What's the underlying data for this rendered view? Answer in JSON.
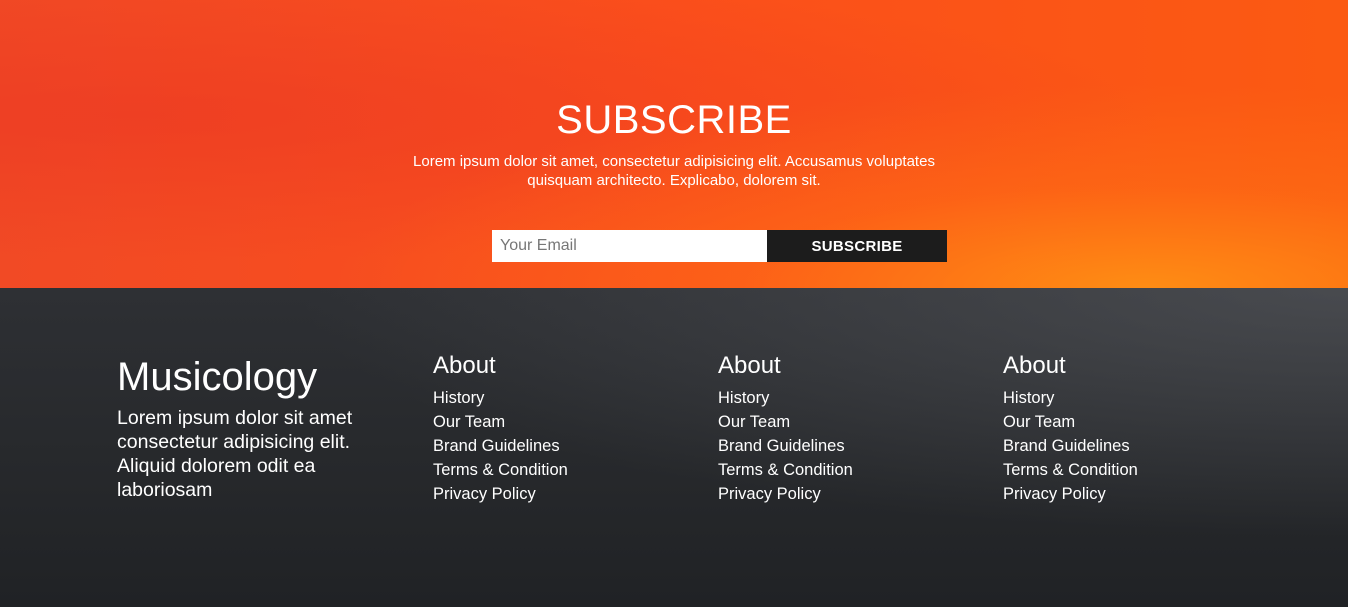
{
  "subscribe": {
    "title": "SUBSCRIBE",
    "description": "Lorem ipsum dolor sit amet, consectetur adipisicing elit. Accusamus voluptates quisquam architecto. Explicabo, dolorem sit.",
    "email_placeholder": "Your Email",
    "email_value": "",
    "button_label": "SUBSCRIBE"
  },
  "footer": {
    "brand": {
      "name": "Musicology",
      "description": "Lorem ipsum dolor sit amet consectetur adipisicing elit. Aliquid dolorem odit ea laboriosam"
    },
    "columns": [
      {
        "title": "About",
        "links": [
          "History",
          "Our Team",
          "Brand Guidelines",
          "Terms & Condition",
          "Privacy Policy"
        ]
      },
      {
        "title": "About",
        "links": [
          "History",
          "Our Team",
          "Brand Guidelines",
          "Terms & Condition",
          "Privacy Policy"
        ]
      },
      {
        "title": "About",
        "links": [
          "History",
          "Our Team",
          "Brand Guidelines",
          "Terms & Condition",
          "Privacy Policy"
        ]
      }
    ]
  },
  "colors": {
    "subscribe_bg": "#fb4f1b",
    "button_bg": "#1c1c1c",
    "footer_bg": "#26282b",
    "text": "#ffffff"
  }
}
